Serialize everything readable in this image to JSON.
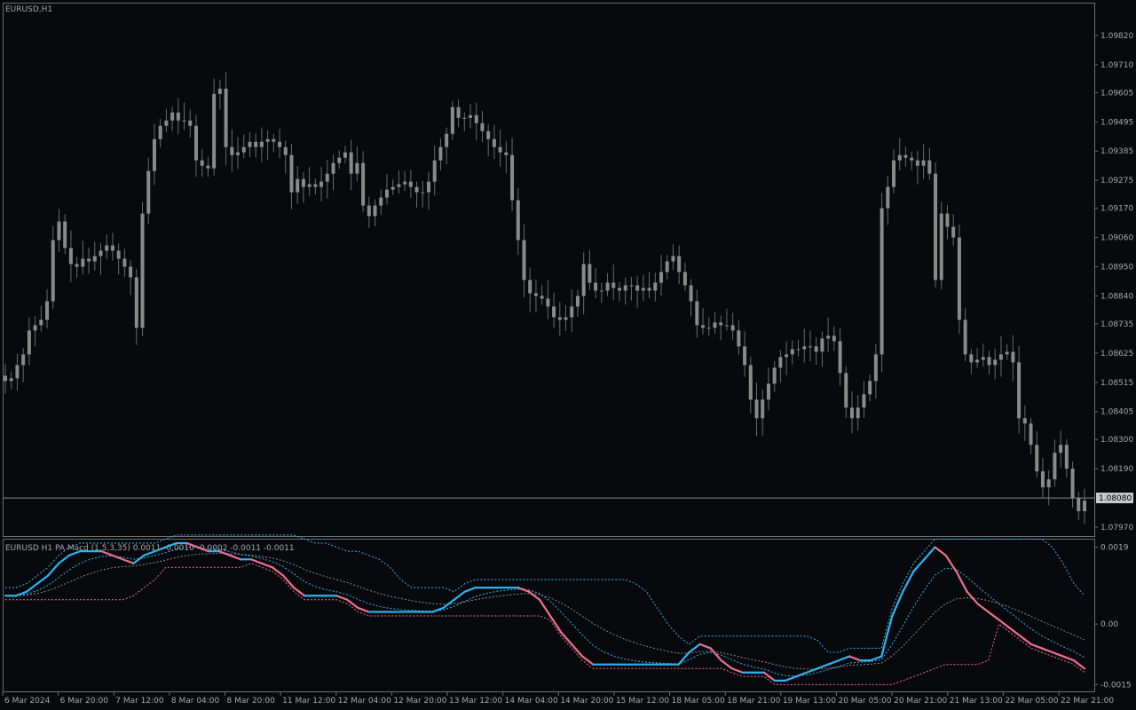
{
  "window": {
    "symbol_label": "EURUSD,H1",
    "indicator_label": "EURUSD H1 PA Macd (1.5,3,35) 0.0011 -0.0010 -0.0002 -0.0011 -0.0011",
    "current_price": "1.08080",
    "current_price_value": 1.0808
  },
  "colors": {
    "background": "#08090d",
    "border": "#6e6e6e",
    "candle": "#8a8a8a",
    "candle_wick": "#6a6a6a",
    "current_price_box": "#c8c8c8",
    "macd_up": "#2fb4f0",
    "macd_down": "#f07090",
    "dashed_blue": "#2fb4f0",
    "dashed_pink": "#f07090",
    "dashed_gray": "#8a8a8a"
  },
  "chart_data": [
    {
      "type": "candlestick",
      "title": "EURUSD,H1",
      "price_axis_ticks": [
        "1.09820",
        "1.09710",
        "1.09605",
        "1.09495",
        "1.09385",
        "1.09275",
        "1.09170",
        "1.09060",
        "1.08950",
        "1.08840",
        "1.08735",
        "1.08625",
        "1.08515",
        "1.08405",
        "1.08300",
        "1.08190",
        "1.07970"
      ],
      "ylim": [
        1.0795,
        1.0992
      ],
      "close_path": [
        1.0852,
        1.0853,
        1.0858,
        1.0862,
        1.0871,
        1.0873,
        1.0875,
        1.0882,
        1.0905,
        1.0912,
        1.0902,
        1.0896,
        1.0895,
        1.0898,
        1.0897,
        1.0899,
        1.0901,
        1.0903,
        1.0901,
        1.0898,
        1.0895,
        1.0891,
        1.0872,
        1.0915,
        1.0931,
        1.0943,
        1.0948,
        1.095,
        1.0953,
        1.095,
        1.095,
        1.0948,
        1.0935,
        1.0933,
        1.0932,
        1.096,
        1.0962,
        1.094,
        1.0937,
        1.0938,
        1.094,
        1.0942,
        1.094,
        1.0942,
        1.0943,
        1.0942,
        1.094,
        1.0937,
        1.0923,
        1.0928,
        1.0925,
        1.0926,
        1.0925,
        1.0927,
        1.093,
        1.0934,
        1.0936,
        1.0938,
        1.093,
        1.0934,
        1.0918,
        1.0914,
        1.0918,
        1.0921,
        1.0924,
        1.0925,
        1.0926,
        1.0927,
        1.0925,
        1.0923,
        1.0923,
        1.0927,
        1.0935,
        1.094,
        1.0945,
        1.0955,
        1.0951,
        1.0951,
        1.0952,
        1.0949,
        1.0946,
        1.0943,
        1.094,
        1.0938,
        1.0937,
        1.092,
        1.0905,
        1.089,
        1.0885,
        1.0884,
        1.0883,
        1.088,
        1.0876,
        1.0875,
        1.0876,
        1.088,
        1.0884,
        1.0896,
        1.0889,
        1.0886,
        1.0886,
        1.0889,
        1.0887,
        1.0886,
        1.0888,
        1.0888,
        1.0886,
        1.0887,
        1.0886,
        1.0889,
        1.0893,
        1.0897,
        1.0899,
        1.0893,
        1.0888,
        1.0882,
        1.0873,
        1.0872,
        1.0872,
        1.0874,
        1.0873,
        1.0873,
        1.0871,
        1.0865,
        1.0858,
        1.0845,
        1.0838,
        1.0845,
        1.0851,
        1.0857,
        1.0861,
        1.0862,
        1.0864,
        1.0864,
        1.0865,
        1.0865,
        1.0863,
        1.0868,
        1.0869,
        1.0867,
        1.0855,
        1.0842,
        1.0838,
        1.0842,
        1.0847,
        1.0852,
        1.0862,
        1.0917,
        1.0925,
        1.0935,
        1.0937,
        1.0936,
        1.0935,
        1.0933,
        1.0935,
        1.093,
        1.089,
        1.0915,
        1.091,
        1.0906,
        1.0875,
        1.0862,
        1.0859,
        1.086,
        1.0861,
        1.0858,
        1.086,
        1.0862,
        1.0863,
        1.0859,
        1.0838,
        1.0836,
        1.0828,
        1.0818,
        1.0812,
        1.0815,
        1.0825,
        1.0828,
        1.0819,
        1.0808,
        1.0803,
        1.0807
      ]
    },
    {
      "type": "line",
      "title": "EURUSD H1 PA Macd (1.5,3,35) 0.0011 -0.0010 -0.0002 -0.0011 -0.0011",
      "value_axis_ticks": [
        "0.0019",
        "0.00",
        "-0.0015"
      ],
      "ylim": [
        -0.0016,
        0.002
      ],
      "series": [
        {
          "values": [
            0.0007,
            0.0007,
            0.0008,
            0.001,
            0.0012,
            0.0015,
            0.0017,
            0.0018,
            0.0018,
            0.0018,
            0.0017,
            0.0016,
            0.0015,
            0.0017,
            0.0018,
            0.0019,
            0.002,
            0.002,
            0.0019,
            0.0018,
            0.0018,
            0.0017,
            0.0016,
            0.0016,
            0.0015,
            0.0014,
            0.0012,
            0.0009,
            0.0007,
            0.0007,
            0.0007,
            0.0007,
            0.0006,
            0.0004,
            0.0003,
            0.0003,
            0.0003,
            0.0003,
            0.0003,
            0.0003,
            0.0003,
            0.0004,
            0.0006,
            0.0008,
            0.0009,
            0.0009,
            0.0009,
            0.0009,
            0.0009,
            0.0008,
            0.0006,
            0.0002,
            -0.0002,
            -0.0005,
            -0.0008,
            -0.001,
            -0.001,
            -0.001,
            -0.001,
            -0.001,
            -0.001,
            -0.001,
            -0.001,
            -0.001,
            -0.0007,
            -0.0005,
            -0.0006,
            -0.0009,
            -0.0011,
            -0.0012,
            -0.0012,
            -0.0012,
            -0.0014,
            -0.0014,
            -0.0013,
            -0.0012,
            -0.0011,
            -0.001,
            -0.0009,
            -0.0008,
            -0.0009,
            -0.0009,
            -0.0008,
            0.0002,
            0.0008,
            0.0013,
            0.0016,
            0.0019,
            0.0017,
            0.0013,
            0.0008,
            0.0005,
            0.0003,
            0.0001,
            -0.0001,
            -0.0003,
            -0.0005,
            -0.0006,
            -0.0007,
            -0.0008,
            -0.0009,
            -0.0011
          ]
        }
      ]
    }
  ],
  "time_axis": {
    "labels": [
      "6 Mar 2024",
      "6 Mar 20:00",
      "7 Mar 12:00",
      "8 Mar 04:00",
      "8 Mar 20:00",
      "11 Mar 12:00",
      "12 Mar 04:00",
      "12 Mar 20:00",
      "13 Mar 12:00",
      "14 Mar 04:00",
      "14 Mar 20:00",
      "15 Mar 12:00",
      "18 Mar 05:00",
      "18 Mar 21:00",
      "19 Mar 13:00",
      "20 Mar 05:00",
      "20 Mar 21:00",
      "21 Mar 13:00",
      "22 Mar 05:00",
      "22 Mar 21:00"
    ]
  }
}
